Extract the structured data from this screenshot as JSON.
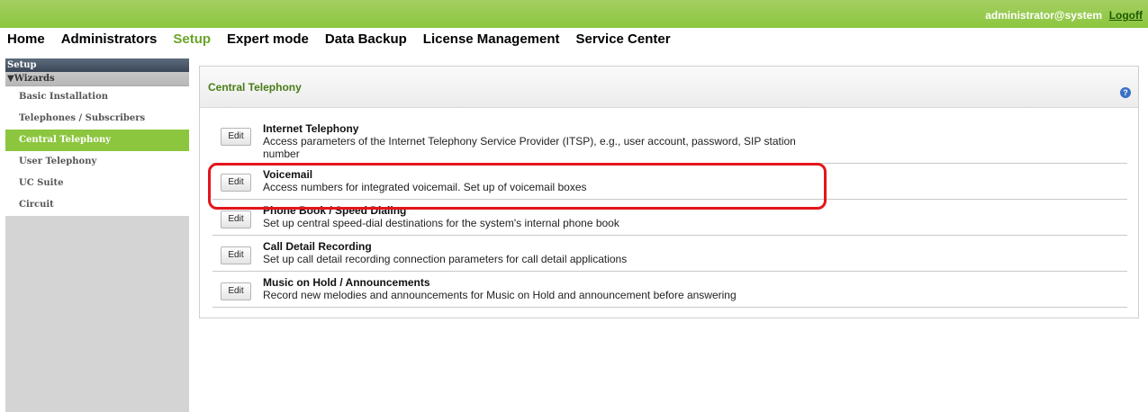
{
  "topbar": {
    "user": "administrator@system",
    "logoff": "Logoff"
  },
  "nav": [
    "Home",
    "Administrators",
    "Setup",
    "Expert mode",
    "Data Backup",
    "License Management",
    "Service Center"
  ],
  "sidebar": {
    "title": "Setup",
    "group": "Wizards",
    "items": [
      "Basic Installation",
      "Telephones / Subscribers",
      "Central Telephony",
      "User Telephony",
      "UC Suite",
      "Circuit"
    ],
    "active": "Central Telephony"
  },
  "panel": {
    "title": "Central Telephony",
    "help_icon": "?",
    "edit_label": "Edit",
    "wizards": [
      {
        "title": "Internet Telephony",
        "desc": "Access parameters of the Internet Telephony Service Provider (ITSP), e.g., user account, password, SIP station number"
      },
      {
        "title": "Voicemail",
        "desc": "Access numbers for integrated voicemail. Set up of voicemail boxes"
      },
      {
        "title": "Phone Book / Speed Dialing",
        "desc": "Set up central speed-dial destinations for the system's internal phone book"
      },
      {
        "title": "Call Detail Recording",
        "desc": "Set up call detail recording connection parameters for call detail applications"
      },
      {
        "title": "Music on Hold / Announcements",
        "desc": "Record new melodies and announcements for Music on Hold and announcement before answering"
      }
    ]
  },
  "colors": {
    "accent": "#8cc63f",
    "nav_active": "#6aa526",
    "highlight": "#e4151b"
  }
}
